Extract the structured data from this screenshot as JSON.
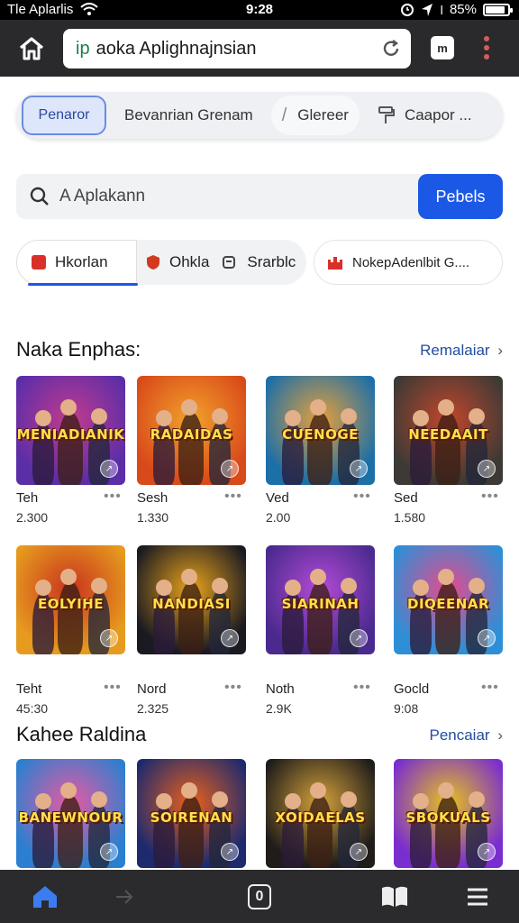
{
  "status_bar": {
    "carrier": "Tle Aplarlis",
    "time": "9:28",
    "battery": "85%"
  },
  "browser": {
    "url_scheme": "ip",
    "url_text": "aoka Aplighnajnsian",
    "tab_count": "m"
  },
  "top_chips": [
    {
      "label": "Penaror"
    },
    {
      "label": "Bevanrian  Grenam"
    },
    {
      "label": "Glereer"
    },
    {
      "label": "Caapor ..."
    }
  ],
  "search": {
    "placeholder": "A Aplakann",
    "button_label": "Pebels"
  },
  "categories": [
    {
      "label": "Hkorlan",
      "icon": "red-square-icon"
    },
    {
      "label": "Ohkla",
      "icon": "shield-icon"
    },
    {
      "label": "Srarblc",
      "icon": "cup-icon"
    },
    {
      "label": "NokepAdenlbit G....",
      "icon": "castle-icon"
    }
  ],
  "section1": {
    "title": "Naka Enphas:",
    "link": "Remalaiar",
    "items": [
      {
        "art": "MENIADIANIK",
        "name": "Teh",
        "count": "2.300",
        "colors": [
          "#5b2ea8",
          "#c23a8e"
        ]
      },
      {
        "art": "RADAIDAS",
        "name": "Sesh",
        "count": "1.330",
        "colors": [
          "#d94a1a",
          "#f1a22b"
        ]
      },
      {
        "art": "CUENOGE",
        "name": "Ved",
        "count": "2.00",
        "colors": [
          "#1d6fa8",
          "#e6a03a"
        ]
      },
      {
        "art": "NEEDAAIT",
        "name": "Sed",
        "count": "1.580",
        "colors": [
          "#3d3a35",
          "#c2462c"
        ]
      },
      {
        "art": "EOLYIHE",
        "name": "Teht",
        "count": "45:30",
        "colors": [
          "#e69b1e",
          "#c8341e"
        ]
      },
      {
        "art": "NANDIASI",
        "name": "Nord",
        "count": "2.325",
        "colors": [
          "#1a1a22",
          "#e8a21c"
        ]
      },
      {
        "art": "SIARINAH",
        "name": "Noth",
        "count": "2.9K",
        "colors": [
          "#4a2a8e",
          "#b44ad6"
        ]
      },
      {
        "art": "DIQEENAR",
        "name": "Gocld",
        "count": "9:08",
        "colors": [
          "#2e8fd6",
          "#e64a8e"
        ]
      }
    ]
  },
  "section2": {
    "title": "Kahee  Raldina",
    "link": "Pencaiar",
    "items": [
      {
        "art": "BANEWNOUR",
        "colors": [
          "#2c7fd0",
          "#e85aa2"
        ]
      },
      {
        "art": "SOIRENAN",
        "colors": [
          "#1e2a6e",
          "#e8601c"
        ]
      },
      {
        "art": "XOIDAELAS",
        "colors": [
          "#1f1c1a",
          "#d4a23a"
        ]
      },
      {
        "art": "SBOKUALS",
        "colors": [
          "#7a2ecf",
          "#e8c21c"
        ]
      }
    ]
  },
  "bottom_nav": {
    "tab_count": "0"
  }
}
